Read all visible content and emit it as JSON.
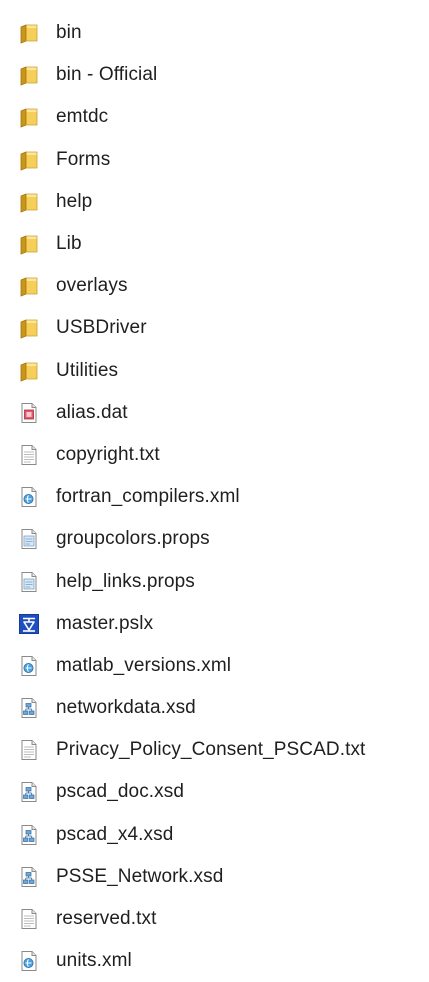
{
  "explorer": {
    "items": [
      {
        "name": "bin",
        "icon": "folder-icon"
      },
      {
        "name": "bin - Official",
        "icon": "folder-icon"
      },
      {
        "name": "emtdc",
        "icon": "folder-icon"
      },
      {
        "name": "Forms",
        "icon": "folder-icon"
      },
      {
        "name": "help",
        "icon": "folder-icon"
      },
      {
        "name": "Lib",
        "icon": "folder-icon"
      },
      {
        "name": "overlays",
        "icon": "folder-icon"
      },
      {
        "name": "USBDriver",
        "icon": "folder-icon"
      },
      {
        "name": "Utilities",
        "icon": "folder-icon"
      },
      {
        "name": "alias.dat",
        "icon": "dat-file-icon"
      },
      {
        "name": "copyright.txt",
        "icon": "text-file-icon"
      },
      {
        "name": "fortran_compilers.xml",
        "icon": "xml-file-icon"
      },
      {
        "name": "groupcolors.props",
        "icon": "props-file-icon"
      },
      {
        "name": "help_links.props",
        "icon": "props-file-icon"
      },
      {
        "name": "master.pslx",
        "icon": "pslx-file-icon"
      },
      {
        "name": "matlab_versions.xml",
        "icon": "xml-file-icon"
      },
      {
        "name": "networkdata.xsd",
        "icon": "xsd-file-icon"
      },
      {
        "name": "Privacy_Policy_Consent_PSCAD.txt",
        "icon": "text-file-icon"
      },
      {
        "name": "pscad_doc.xsd",
        "icon": "xsd-file-icon"
      },
      {
        "name": "pscad_x4.xsd",
        "icon": "xsd-file-icon"
      },
      {
        "name": "PSSE_Network.xsd",
        "icon": "xsd-file-icon"
      },
      {
        "name": "reserved.txt",
        "icon": "text-file-icon"
      },
      {
        "name": "units.xml",
        "icon": "xml-file-icon"
      }
    ]
  }
}
